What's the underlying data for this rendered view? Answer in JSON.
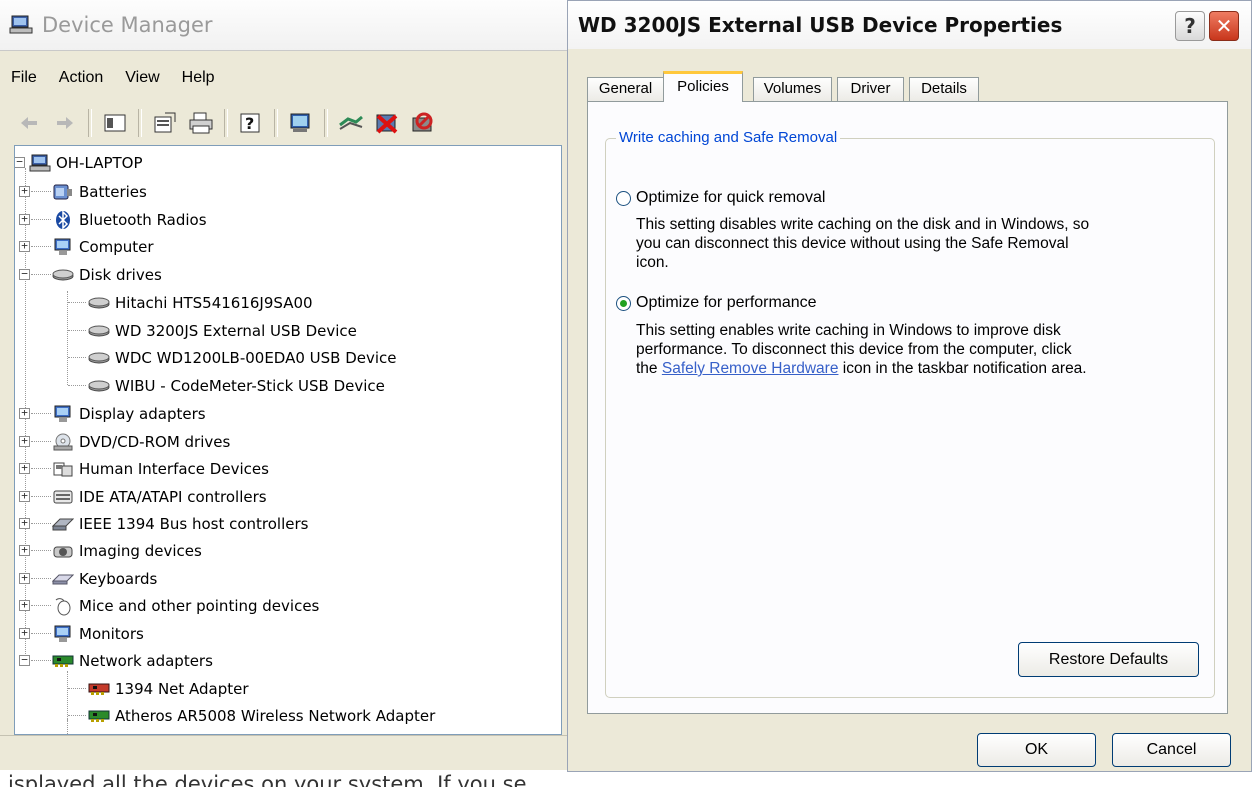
{
  "background_text": "isplayed all the devices on your system. If you se",
  "device_manager": {
    "title": "Device Manager",
    "menu": [
      "File",
      "Action",
      "View",
      "Help"
    ],
    "tree": {
      "root": "OH-LAPTOP",
      "nodes": [
        {
          "label": "Batteries",
          "expanded": false,
          "icon": "battery-icon"
        },
        {
          "label": "Bluetooth Radios",
          "expanded": false,
          "icon": "bluetooth-icon"
        },
        {
          "label": "Computer",
          "expanded": false,
          "icon": "computer-icon"
        },
        {
          "label": "Disk drives",
          "expanded": true,
          "icon": "disk-drive-icon",
          "children": [
            "Hitachi HTS541616J9SA00",
            "WD 3200JS External USB Device",
            "WDC WD1200LB-00EDA0 USB Device",
            "WIBU - CodeMeter-Stick USB Device"
          ]
        },
        {
          "label": "Display adapters",
          "expanded": false,
          "icon": "display-adapter-icon"
        },
        {
          "label": "DVD/CD-ROM drives",
          "expanded": false,
          "icon": "dvd-icon"
        },
        {
          "label": "Human Interface Devices",
          "expanded": false,
          "icon": "hid-icon"
        },
        {
          "label": "IDE ATA/ATAPI controllers",
          "expanded": false,
          "icon": "ide-icon"
        },
        {
          "label": "IEEE 1394 Bus host controllers",
          "expanded": false,
          "icon": "ieee1394-icon"
        },
        {
          "label": "Imaging devices",
          "expanded": false,
          "icon": "camera-icon"
        },
        {
          "label": "Keyboards",
          "expanded": false,
          "icon": "keyboard-icon"
        },
        {
          "label": "Mice and other pointing devices",
          "expanded": false,
          "icon": "mouse-icon"
        },
        {
          "label": "Monitors",
          "expanded": false,
          "icon": "monitor-icon"
        },
        {
          "label": "Network adapters",
          "expanded": true,
          "icon": "network-adapter-icon",
          "children": [
            "1394 Net Adapter",
            "Atheros AR5008 Wireless Network Adapter"
          ]
        }
      ]
    }
  },
  "properties": {
    "title": "WD 3200JS External USB Device Properties",
    "help_glyph": "?",
    "close_glyph": "✕",
    "tabs": [
      "General",
      "Policies",
      "Volumes",
      "Driver",
      "Details"
    ],
    "active_tab": "Policies",
    "group_title": "Write caching and Safe Removal",
    "option1": {
      "label": "Optimize for quick removal",
      "selected": false,
      "description": [
        "This setting disables write caching on the disk and in Windows, so",
        "you can disconnect this device without using the Safe Removal",
        "icon."
      ]
    },
    "option2": {
      "label": "Optimize for performance",
      "selected": true,
      "desc_line1": "This setting enables write caching in Windows to improve disk",
      "desc_line2": "performance. To disconnect this device from the computer, click",
      "desc_line3_pre": "the ",
      "desc_link": "Safely Remove Hardware",
      "desc_line3_post": " icon in the taskbar notification area."
    },
    "restore_button": "Restore Defaults",
    "ok_button": "OK",
    "cancel_button": "Cancel"
  }
}
